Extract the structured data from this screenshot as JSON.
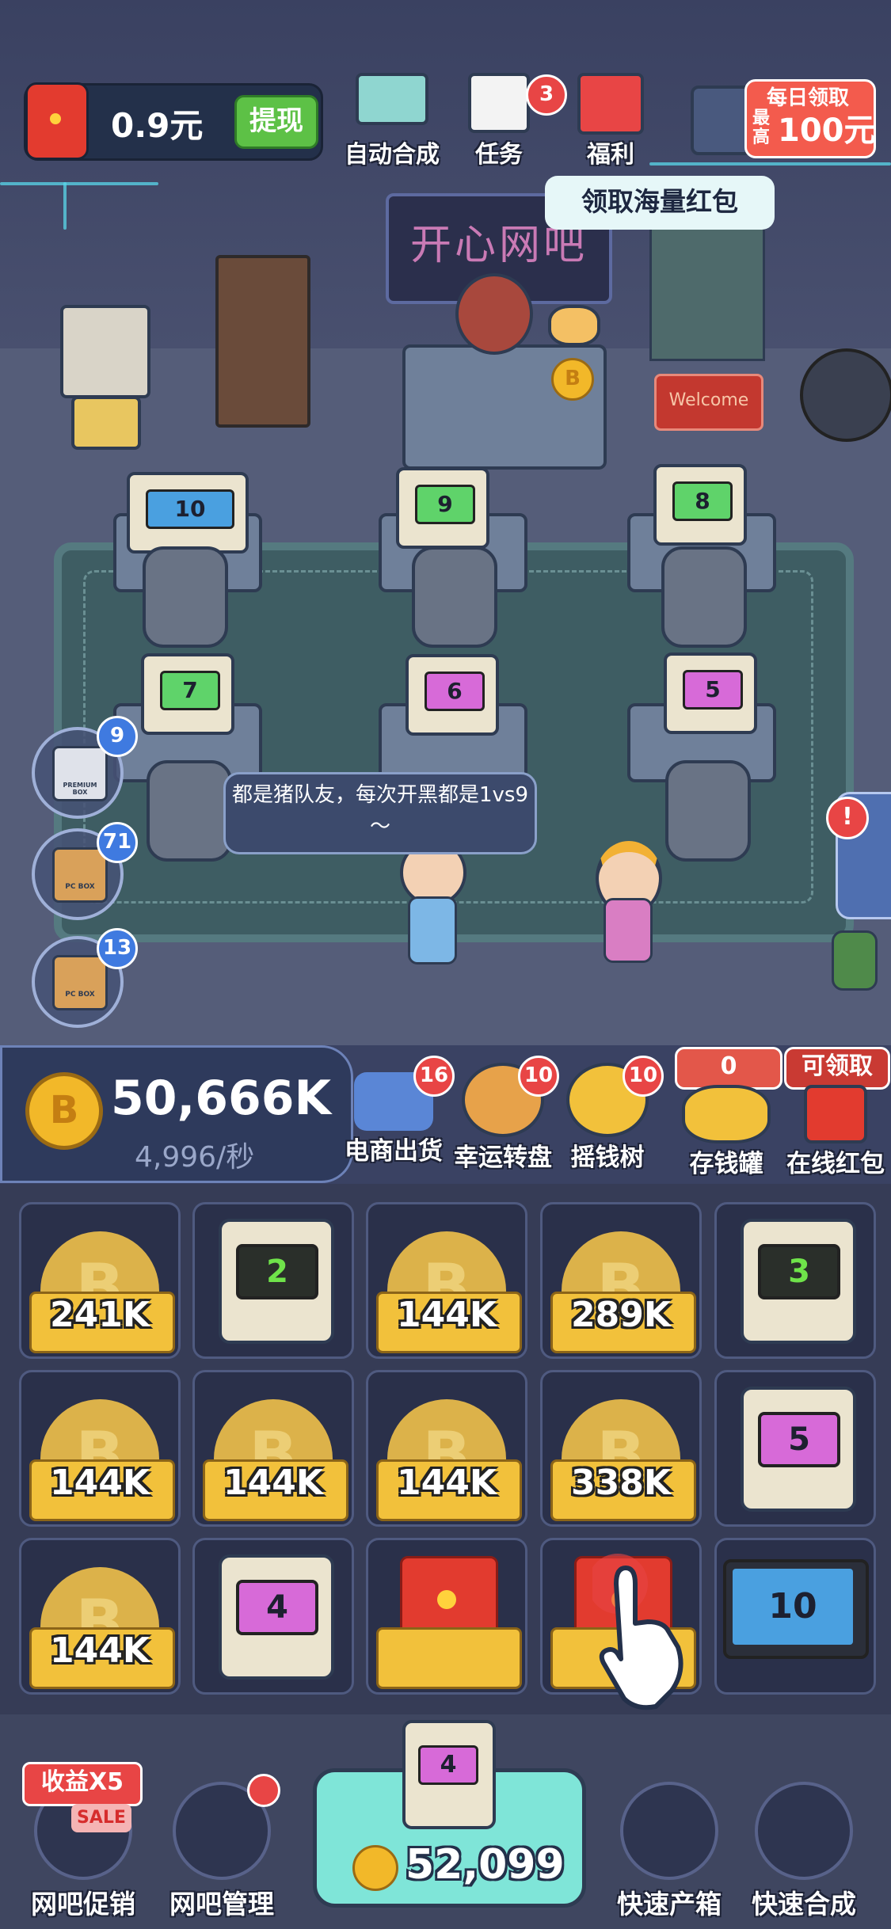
{
  "header": {
    "cash": "0.9元",
    "withdraw_label": "提现",
    "auto_merge_label": "自动合成",
    "tasks_label": "任务",
    "tasks_badge": "3",
    "welfare_label": "福利",
    "daily_line1": "每日领取",
    "daily_line2": "最高",
    "daily_amount": "100元",
    "tooltip": "领取海量红包"
  },
  "scene": {
    "sign": "开心网吧",
    "welcome": "Welcome",
    "speech": "都是猪队友，每次开黑都是1vs9～",
    "computers": [
      "10",
      "9",
      "8",
      "7",
      "6",
      "5"
    ],
    "premium_box_label": "PREMIUM BOX",
    "pc_box_label": "PC BOX",
    "side_boxes": [
      {
        "badge": "9",
        "type": "premium"
      },
      {
        "badge": "71",
        "type": "pc"
      },
      {
        "badge": "13",
        "type": "pc"
      }
    ],
    "alert": "!"
  },
  "stats": {
    "coin_symbol": "B",
    "coins": "50,666K",
    "rate": "4,996/秒"
  },
  "features": [
    {
      "label": "电商出货",
      "badge": "16"
    },
    {
      "label": "幸运转盘",
      "badge": "10"
    },
    {
      "label": "摇钱树",
      "badge": "10"
    },
    {
      "label": "存钱罐",
      "badge": "0"
    },
    {
      "label": "在线红包",
      "badge": "可领取"
    }
  ],
  "grid": [
    {
      "type": "coin",
      "value": "241K"
    },
    {
      "type": "pc",
      "value": "2",
      "screen": "#2a2f2a",
      "text": "#6fe34a"
    },
    {
      "type": "coin",
      "value": "144K"
    },
    {
      "type": "coin",
      "value": "289K"
    },
    {
      "type": "pc",
      "value": "3",
      "screen": "#2a2f2a",
      "text": "#6fe34a"
    },
    {
      "type": "coin",
      "value": "144K"
    },
    {
      "type": "coin",
      "value": "144K"
    },
    {
      "type": "coin",
      "value": "144K"
    },
    {
      "type": "coin",
      "value": "338K"
    },
    {
      "type": "pc",
      "value": "5",
      "screen": "#d76ad8",
      "text": "#1d2030"
    },
    {
      "type": "coin",
      "value": "144K"
    },
    {
      "type": "pc",
      "value": "4",
      "screen": "#d76ad8",
      "text": "#1d2030"
    },
    {
      "type": "redbox",
      "value": ""
    },
    {
      "type": "redbox",
      "value": ""
    },
    {
      "type": "monitor",
      "value": "10",
      "screen": "#4aa0e0",
      "text": "#1d2030"
    }
  ],
  "bottom": {
    "promo_tag": "收益X5",
    "sale": "SALE",
    "promo_label": "网吧促销",
    "manage_label": "网吧管理",
    "buy_level": "4",
    "buy_price": "52,099",
    "quick_box_label": "快速产箱",
    "quick_merge_label": "快速合成"
  }
}
